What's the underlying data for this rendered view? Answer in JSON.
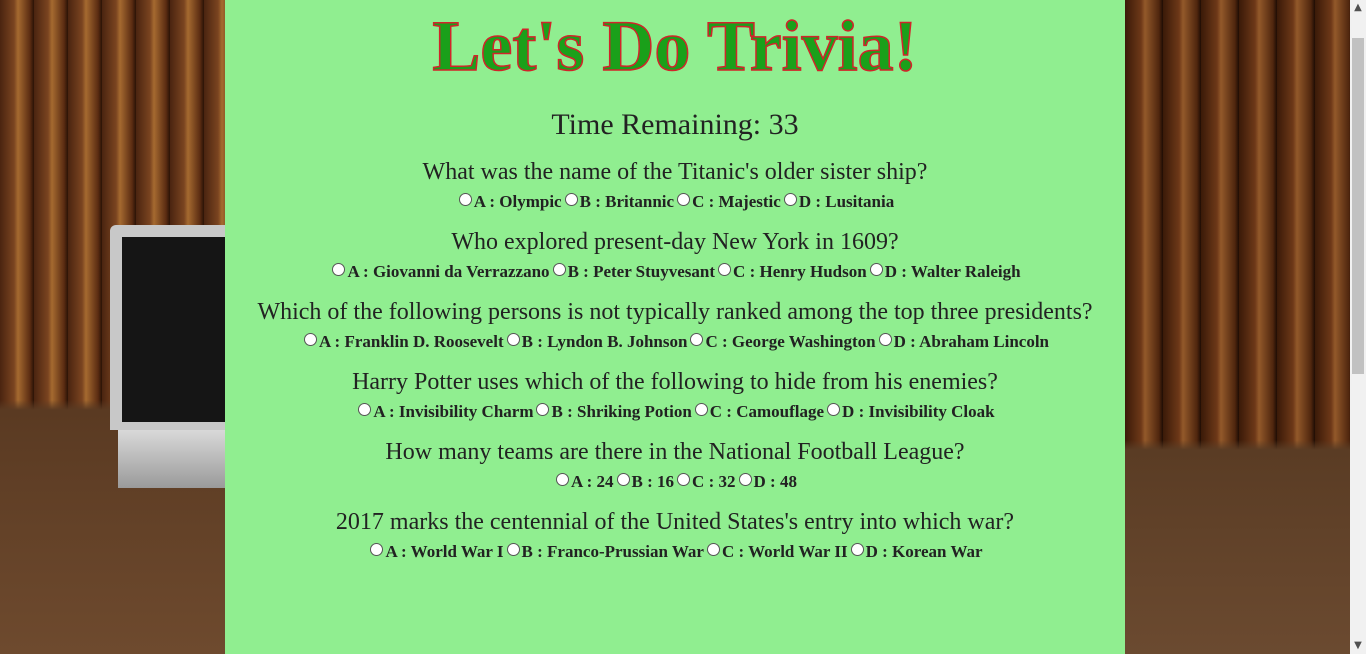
{
  "header": {
    "title": "Let's Do Trivia!"
  },
  "timer": {
    "label": "Time Remaining: 33"
  },
  "questions": [
    {
      "text": "What was the name of the Titanic's older sister ship?",
      "options": [
        "A : Olympic",
        "B : Britannic",
        "C : Majestic",
        "D : Lusitania"
      ]
    },
    {
      "text": "Who explored present-day New York in 1609?",
      "options": [
        "A : Giovanni da Verrazzano",
        "B : Peter Stuyvesant",
        "C : Henry Hudson",
        "D : Walter Raleigh"
      ]
    },
    {
      "text": "Which of the following persons is not typically ranked among the top three presidents?",
      "options": [
        "A : Franklin D. Roosevelt",
        "B : Lyndon B. Johnson",
        "C : George Washington",
        "D : Abraham Lincoln"
      ]
    },
    {
      "text": "Harry Potter uses which of the following to hide from his enemies?",
      "options": [
        "A : Invisibility Charm",
        "B : Shriking Potion",
        "C : Camouflage",
        "D : Invisibility Cloak"
      ]
    },
    {
      "text": "How many teams are there in the National Football League?",
      "options": [
        "A : 24",
        "B : 16",
        "C : 32",
        "D : 48"
      ]
    },
    {
      "text": "2017 marks the centennial of the United States's entry into which war?",
      "options": [
        "A : World War I",
        "B : Franco-Prussian War",
        "C : World War II",
        "D : Korean War"
      ]
    }
  ],
  "colors": {
    "panel": "#90ee90",
    "title_fill": "#1aa01a",
    "title_stroke": "#d2232a"
  },
  "icons": {
    "scroll_up": "scroll-up-arrow-icon",
    "scroll_down": "scroll-down-arrow-icon",
    "radio": "radio-button-icon"
  }
}
